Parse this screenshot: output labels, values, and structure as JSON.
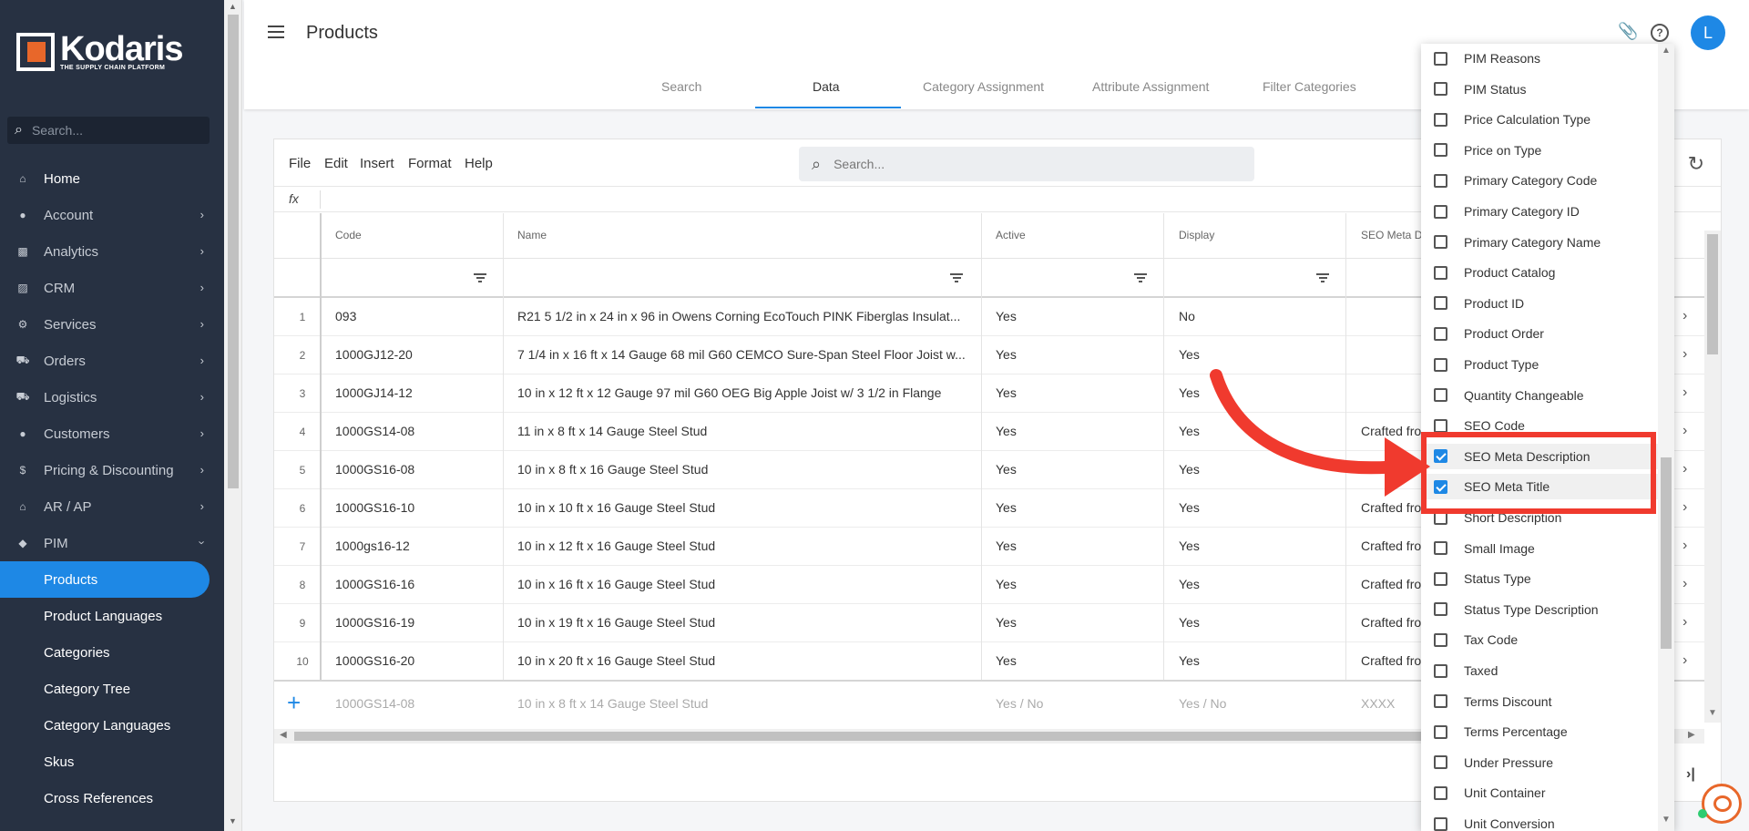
{
  "sidebar": {
    "brand": "Kodaris",
    "tagline": "THE SUPPLY CHAIN PLATFORM",
    "search_placeholder": "Search...",
    "items": [
      {
        "label": "Home",
        "icon": "home-icon"
      },
      {
        "label": "Account",
        "icon": "person-icon"
      },
      {
        "label": "Analytics",
        "icon": "analytics-icon"
      },
      {
        "label": "CRM",
        "icon": "crm-icon"
      },
      {
        "label": "Services",
        "icon": "services-icon"
      },
      {
        "label": "Orders",
        "icon": "truck-icon"
      },
      {
        "label": "Logistics",
        "icon": "logistics-icon"
      },
      {
        "label": "Customers",
        "icon": "people-icon"
      },
      {
        "label": "Pricing & Discounting",
        "icon": "dollar-icon"
      },
      {
        "label": "AR / AP",
        "icon": "bank-icon"
      },
      {
        "label": "PIM",
        "icon": "tag-icon"
      }
    ],
    "subitems": [
      "Products",
      "Product Languages",
      "Categories",
      "Category Tree",
      "Category Languages",
      "Skus",
      "Cross References"
    ]
  },
  "header": {
    "title": "Products",
    "avatar_initial": "L",
    "tabs": [
      "Search",
      "Data",
      "Category Assignment",
      "Attribute Assignment",
      "Filter Categories"
    ],
    "active_tab": "Data"
  },
  "grid": {
    "menu": [
      "File",
      "Edit",
      "Insert",
      "Format",
      "Help"
    ],
    "search_placeholder": "Search...",
    "fx_label": "fx",
    "columns": [
      "Code",
      "Name",
      "Active",
      "Display",
      "SEO Meta D"
    ],
    "rows": [
      {
        "n": "1",
        "code": "093",
        "name": "R21 5 1/2 in x 24 in x 96 in Owens Corning EcoTouch PINK Fiberglas Insulat...",
        "active": "Yes",
        "display": "No",
        "seo": ""
      },
      {
        "n": "2",
        "code": "1000GJ12-20",
        "name": "7 1/4 in x 16 ft x 14 Gauge 68 mil G60 CEMCO Sure-Span Steel Floor Joist w...",
        "active": "Yes",
        "display": "Yes",
        "seo": ""
      },
      {
        "n": "3",
        "code": "1000GJ14-12",
        "name": "10 in x 12 ft x 12 Gauge 97 mil G60 OEG Big Apple Joist w/ 3 1/2 in Flange",
        "active": "Yes",
        "display": "Yes",
        "seo": ""
      },
      {
        "n": "4",
        "code": "1000GS14-08",
        "name": "11 in x 8 ft x 14 Gauge Steel Stud",
        "active": "Yes",
        "display": "Yes",
        "seo": "Crafted fro"
      },
      {
        "n": "5",
        "code": "1000GS16-08",
        "name": "10 in x 8 ft x 16 Gauge Steel Stud",
        "active": "Yes",
        "display": "Yes",
        "seo": "Crafted fro"
      },
      {
        "n": "6",
        "code": "1000GS16-10",
        "name": "10 in x 10 ft x 16 Gauge Steel Stud",
        "active": "Yes",
        "display": "Yes",
        "seo": "Crafted fro"
      },
      {
        "n": "7",
        "code": "1000gs16-12",
        "name": "10 in x 12 ft x 16 Gauge Steel Stud",
        "active": "Yes",
        "display": "Yes",
        "seo": "Crafted fro"
      },
      {
        "n": "8",
        "code": "1000GS16-16",
        "name": "10 in x 16 ft x 16 Gauge Steel Stud",
        "active": "Yes",
        "display": "Yes",
        "seo": "Crafted fro"
      },
      {
        "n": "9",
        "code": "1000GS16-19",
        "name": "10 in x 19 ft x 16 Gauge Steel Stud",
        "active": "Yes",
        "display": "Yes",
        "seo": "Crafted fro"
      },
      {
        "n": "10",
        "code": "1000GS16-20",
        "name": "10 in x 20 ft x 16 Gauge Steel Stud",
        "active": "Yes",
        "display": "Yes",
        "seo": "Crafted fro"
      }
    ],
    "new_row": {
      "code": "1000GS14-08",
      "name": "10 in x 8 ft x 14 Gauge Steel Stud",
      "active": "Yes / No",
      "display": "Yes / No",
      "seo": "XXXX"
    }
  },
  "picker": {
    "options": [
      {
        "label": "PIM Reasons",
        "checked": false
      },
      {
        "label": "PIM Status",
        "checked": false
      },
      {
        "label": "Price Calculation Type",
        "checked": false
      },
      {
        "label": "Price on Type",
        "checked": false
      },
      {
        "label": "Primary Category Code",
        "checked": false
      },
      {
        "label": "Primary Category ID",
        "checked": false
      },
      {
        "label": "Primary Category Name",
        "checked": false
      },
      {
        "label": "Product Catalog",
        "checked": false
      },
      {
        "label": "Product ID",
        "checked": false
      },
      {
        "label": "Product Order",
        "checked": false
      },
      {
        "label": "Product Type",
        "checked": false
      },
      {
        "label": "Quantity Changeable",
        "checked": false
      },
      {
        "label": "SEO Code",
        "checked": false
      },
      {
        "label": "SEO Meta Description",
        "checked": true
      },
      {
        "label": "SEO Meta Title",
        "checked": true
      },
      {
        "label": "Short Description",
        "checked": false
      },
      {
        "label": "Small Image",
        "checked": false
      },
      {
        "label": "Status Type",
        "checked": false
      },
      {
        "label": "Status Type Description",
        "checked": false
      },
      {
        "label": "Tax Code",
        "checked": false
      },
      {
        "label": "Taxed",
        "checked": false
      },
      {
        "label": "Terms Discount",
        "checked": false
      },
      {
        "label": "Terms Percentage",
        "checked": false
      },
      {
        "label": "Under Pressure",
        "checked": false
      },
      {
        "label": "Unit Container",
        "checked": false
      },
      {
        "label": "Unit Conversion",
        "checked": false
      }
    ]
  },
  "colors": {
    "accent": "#1e88e5",
    "sidebar": "#273142",
    "annotation": "#f03a2e",
    "brand_orange": "#e8672a"
  }
}
